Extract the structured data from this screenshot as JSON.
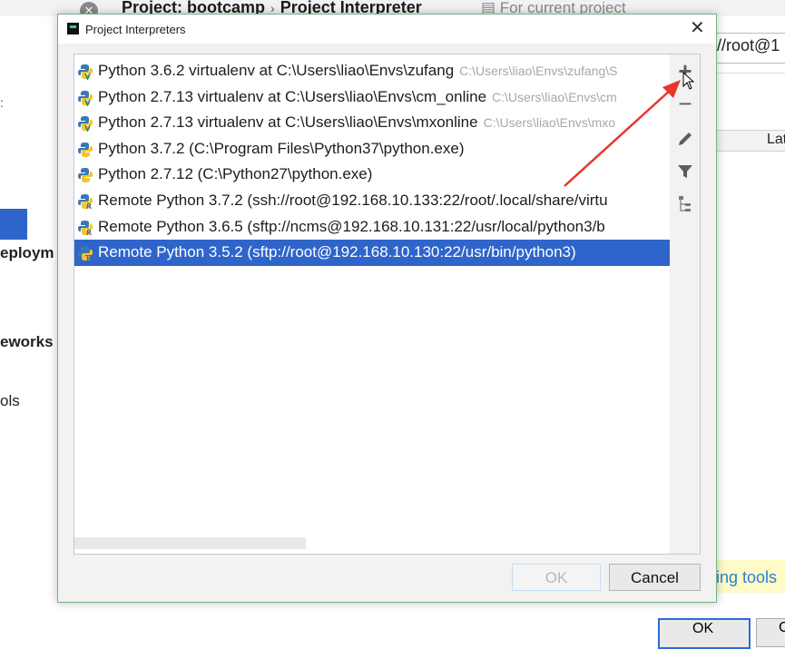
{
  "background": {
    "breadcrumb": [
      "Project: bootcamp",
      "Project Interpreter"
    ],
    "scope_label": "For current project",
    "path_field_value": "//root@1",
    "table_header": "Lat",
    "sidebar": {
      "deployment": "eploym",
      "frameworks": "eworks",
      "tools": "ols"
    },
    "hint_text": "ing tools",
    "ok_label": "OK",
    "cancel_label": "C"
  },
  "dialog": {
    "title": "Project Interpreters",
    "interpreters": [
      {
        "name": "Python 3.6.2 virtualenv at C:\\Users\\liao\\Envs\\zufang",
        "path": "C:\\Users\\liao\\Envs\\zufang\\S",
        "icon": "python-virtualenv-icon",
        "selected": false
      },
      {
        "name": "Python 2.7.13 virtualenv at C:\\Users\\liao\\Envs\\cm_online",
        "path": "C:\\Users\\liao\\Envs\\cm",
        "icon": "python-virtualenv-icon",
        "selected": false
      },
      {
        "name": "Python 2.7.13 virtualenv at C:\\Users\\liao\\Envs\\mxonline",
        "path": "C:\\Users\\liao\\Envs\\mxo",
        "icon": "python-virtualenv-icon",
        "selected": false
      },
      {
        "name": "Python 3.7.2 (C:\\Program Files\\Python37\\python.exe)",
        "path": "",
        "icon": "python-icon",
        "selected": false
      },
      {
        "name": "Python 2.7.12 (C:\\Python27\\python.exe)",
        "path": "",
        "icon": "python-icon",
        "selected": false
      },
      {
        "name": "Remote Python 3.7.2 (ssh://root@192.168.10.133:22/root/.local/share/virtu",
        "path": "",
        "icon": "remote-python-icon",
        "selected": false
      },
      {
        "name": "Remote Python 3.6.5 (sftp://ncms@192.168.10.131:22/usr/local/python3/b",
        "path": "",
        "icon": "remote-python-icon",
        "selected": false
      },
      {
        "name": "Remote Python 3.5.2 (sftp://root@192.168.10.130:22/usr/bin/python3)",
        "path": "",
        "icon": "remote-python-icon",
        "selected": true
      }
    ],
    "toolbar": {
      "add": "+",
      "remove": "−"
    },
    "ok_label": "OK",
    "cancel_label": "Cancel"
  },
  "colors": {
    "selection": "#2f65ca",
    "annotation_arrow": "#e8362d",
    "dialog_border": "#74b286"
  }
}
